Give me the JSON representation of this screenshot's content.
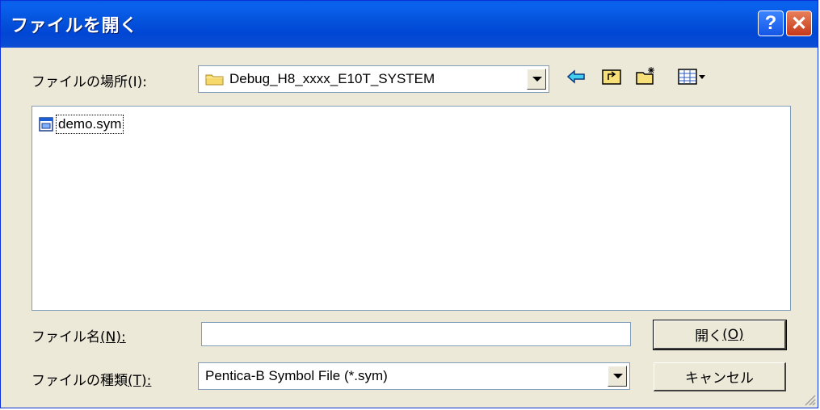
{
  "window": {
    "title": "ファイルを開く",
    "help_label": "?",
    "close_label": "✕"
  },
  "look_in": {
    "label": "ファイルの場所",
    "accel": "(I):",
    "value": "Debug_H8_xxxx_E10T_SYSTEM"
  },
  "toolbar": {
    "icons": [
      "back-arrow-icon",
      "up-folder-icon",
      "new-folder-icon",
      "view-menu-icon"
    ]
  },
  "files": [
    {
      "name": "demo.sym",
      "icon": "symbol-file-icon"
    }
  ],
  "filename": {
    "label": "ファイル名",
    "accel": "(N):",
    "value": ""
  },
  "filetype": {
    "label": "ファイルの種類",
    "accel": "(T):",
    "value": "Pentica-B Symbol File (*.sym)"
  },
  "buttons": {
    "open_label": "開く",
    "open_accel": "(O)",
    "cancel_label": "キャンセル"
  },
  "colors": {
    "title_bar": "#0452db",
    "dialog_bg": "#ece9d8",
    "close_button": "#c5381a",
    "help_button": "#1556e6"
  }
}
